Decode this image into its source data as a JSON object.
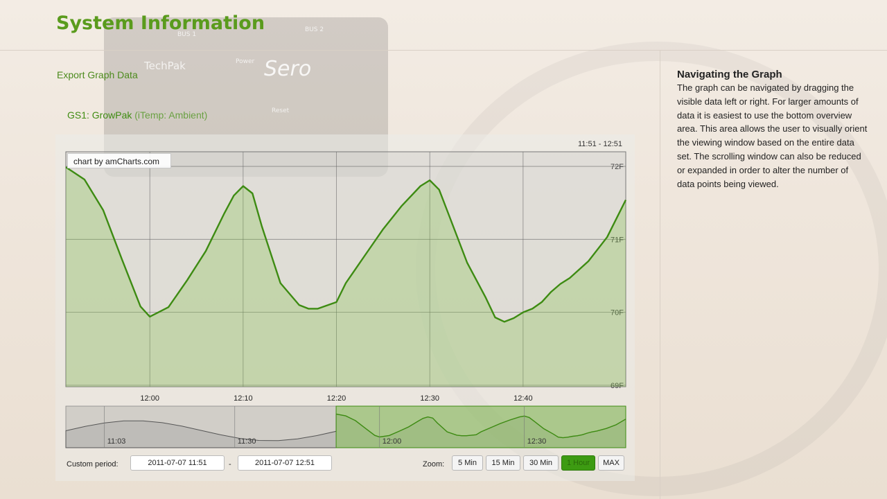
{
  "page": {
    "title": "System Information",
    "export_link": "Export Graph Data"
  },
  "device": {
    "bus1": "BUS 1",
    "bus2": "BUS 2",
    "name": "TechPak",
    "power": "Power",
    "logo": "Sero",
    "reset": "Reset"
  },
  "graph": {
    "sensor_name": "GS1: GrowPak",
    "sensor_sub": "(iTemp: Ambient)",
    "range_label": "11:51 - 12:51",
    "credit": "chart by amCharts.com"
  },
  "chart_data": {
    "type": "area",
    "xlim": [
      "11:51",
      "12:51"
    ],
    "ylim": [
      68.98,
      72.2
    ],
    "x_ticks": [
      "12:00",
      "12:10",
      "12:20",
      "12:30",
      "12:40"
    ],
    "y_ticks": [
      "72F",
      "71F",
      "70F",
      "69F"
    ],
    "grid": true,
    "colors": {
      "line": "#3d8b12",
      "fill": "#7cc242"
    },
    "series": [
      {
        "x": [
          "11:51",
          "11:53",
          "11:55",
          "11:57",
          "11:59",
          "12:00",
          "12:02",
          "12:04",
          "12:06",
          "12:08",
          "12:09",
          "12:10",
          "12:11",
          "12:12",
          "12:14",
          "12:16",
          "12:17",
          "12:18",
          "12:20",
          "12:21",
          "12:23",
          "12:25",
          "12:27",
          "12:29",
          "12:30",
          "12:31",
          "12:32",
          "12:34",
          "12:36",
          "12:37",
          "12:38",
          "12:39",
          "12:40",
          "12:41",
          "12:42",
          "12:43",
          "12:44",
          "12:45",
          "12:47",
          "12:49",
          "12:51"
        ],
        "values": [
          71.99,
          71.82,
          71.4,
          70.73,
          70.08,
          69.94,
          70.07,
          70.44,
          70.84,
          71.36,
          71.6,
          71.73,
          71.63,
          71.18,
          70.4,
          70.1,
          70.05,
          70.05,
          70.14,
          70.4,
          70.77,
          71.14,
          71.46,
          71.73,
          71.81,
          71.68,
          71.35,
          70.68,
          70.2,
          69.93,
          69.87,
          69.92,
          70.0,
          70.05,
          70.14,
          70.28,
          70.39,
          70.47,
          70.7,
          71.03,
          71.54
        ]
      }
    ],
    "navigator": {
      "x_labels": [
        "11:03",
        "11:30",
        "12:00",
        "12:30"
      ],
      "selected_range": [
        "11:51",
        "12:51"
      ]
    }
  },
  "controls": {
    "custom_period_label": "Custom period:",
    "start_date": "2011-07-07 11:51",
    "range_separator": "-",
    "end_date": "2011-07-07 12:51",
    "zoom_label": "Zoom:",
    "zoom_options": [
      "5 Min",
      "15 Min",
      "30 Min",
      "1 Hour",
      "MAX"
    ],
    "active_zoom": "1 Hour"
  },
  "help": {
    "title": "Navigating the Graph",
    "body": "The graph can be navigated by dragging the visible data left or right. For larger amounts of data it is easiest to use the bottom overview area.  This area allows the user to visually orient the viewing window based on the entire data set. The scrolling window can also be reduced or expanded in order to alter the number of data points being viewed."
  }
}
